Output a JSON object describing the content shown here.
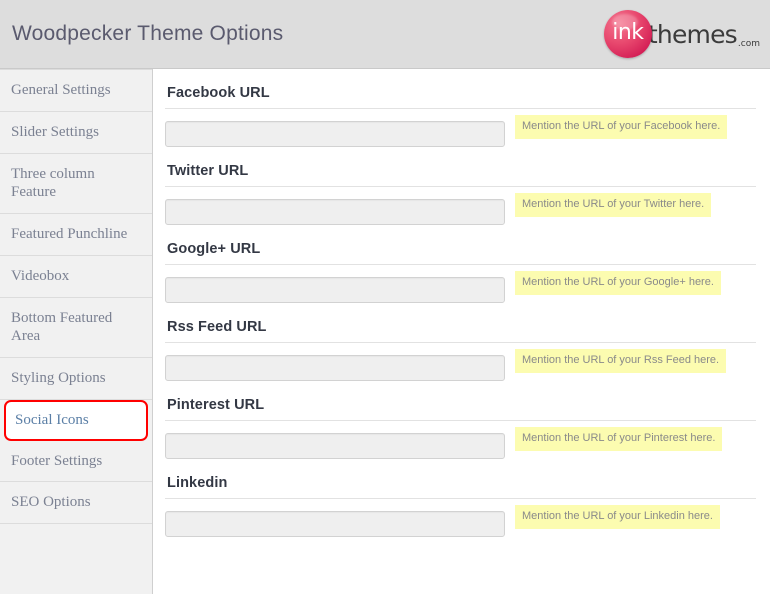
{
  "header": {
    "title": "Woodpecker Theme Options",
    "logo": {
      "mark": "ink",
      "word": "themes",
      "tld": ".com"
    }
  },
  "sidebar": {
    "items": [
      {
        "label": "General Settings",
        "active": false
      },
      {
        "label": "Slider Settings",
        "active": false
      },
      {
        "label": "Three column Feature",
        "active": false
      },
      {
        "label": "Featured Punchline",
        "active": false
      },
      {
        "label": "Videobox",
        "active": false
      },
      {
        "label": "Bottom Featured Area",
        "active": false
      },
      {
        "label": "Styling Options",
        "active": false
      },
      {
        "label": "Social Icons",
        "active": true
      },
      {
        "label": "Footer Settings",
        "active": false
      },
      {
        "label": "SEO Options",
        "active": false
      }
    ],
    "active_highlight_color": "#ff0000"
  },
  "main": {
    "fields": [
      {
        "label": "Facebook URL",
        "value": "",
        "placeholder": "",
        "hint": "Mention the URL of your Facebook here."
      },
      {
        "label": "Twitter URL",
        "value": "",
        "placeholder": "",
        "hint": "Mention the URL of your Twitter here."
      },
      {
        "label": "Google+ URL",
        "value": "",
        "placeholder": "",
        "hint": "Mention the URL of your Google+ here."
      },
      {
        "label": "Rss Feed URL",
        "value": "",
        "placeholder": "",
        "hint": "Mention the URL of your Rss Feed here."
      },
      {
        "label": "Pinterest URL",
        "value": "",
        "placeholder": "",
        "hint": "Mention the URL of your Pinterest here."
      },
      {
        "label": "Linkedin",
        "value": "",
        "placeholder": "",
        "hint": "Mention the URL of your Linkedin here."
      }
    ]
  },
  "colors": {
    "header_bg": "#dddddd",
    "sidebar_bg": "#f1f1f1",
    "hint_bg": "#fcfcb0",
    "input_bg": "#efefef",
    "accent_pink": "#e8486e",
    "active_border": "#ff0000"
  }
}
